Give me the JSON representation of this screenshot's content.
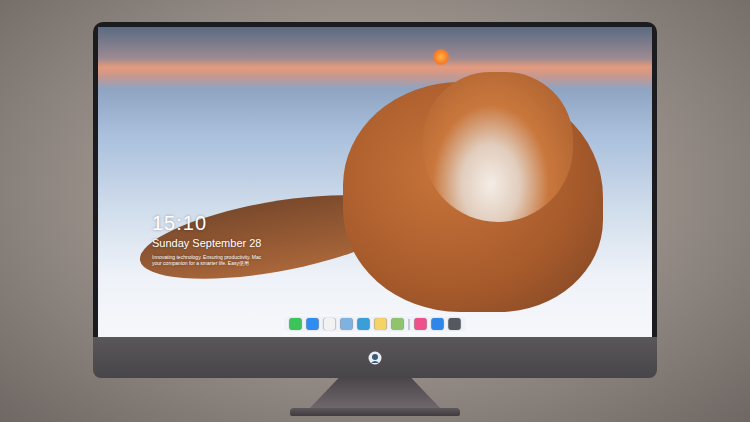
{
  "lock_screen": {
    "time": "15:10",
    "date": "Sunday September 28",
    "tagline": "Innovating technology. Ensuring productivity. Mac your companion for a smarter life. Easy使用"
  },
  "dock": {
    "items": [
      {
        "kind": "app",
        "color": "#3cc35a"
      },
      {
        "kind": "app",
        "color": "#2f8cf0"
      },
      {
        "kind": "app",
        "color": "#f2f2f2"
      },
      {
        "kind": "app",
        "color": "#7fb2e0"
      },
      {
        "kind": "app",
        "color": "#3a9fd8"
      },
      {
        "kind": "app",
        "color": "#f6d365"
      },
      {
        "kind": "app",
        "color": "#8fc46a"
      },
      {
        "kind": "separator",
        "color": "#9aa0a8"
      },
      {
        "kind": "app",
        "color": "#f0508a"
      },
      {
        "kind": "app",
        "color": "#2e86ea"
      },
      {
        "kind": "app",
        "color": "#55585e"
      }
    ]
  }
}
